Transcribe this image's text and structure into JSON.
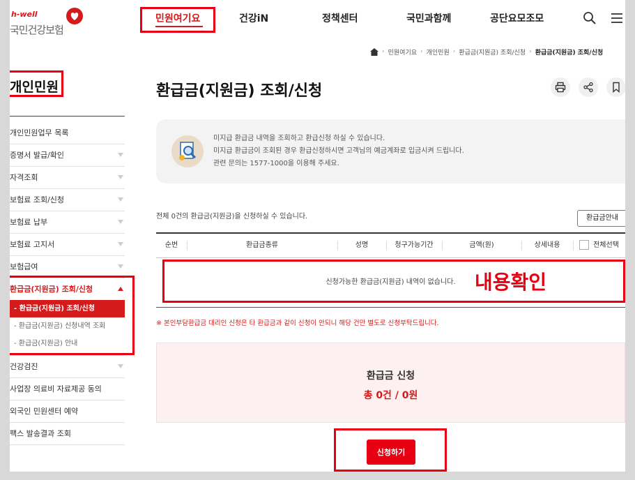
{
  "logo": {
    "en": "h-well",
    "ko": "국민건강보험"
  },
  "gnb": {
    "items": [
      "민원여기요",
      "건강iN",
      "정책센터",
      "국민과함께",
      "공단요모조모"
    ]
  },
  "breadcrumb": [
    "민원여기요",
    "개인민원",
    "환급금(지원금) 조회/신청",
    "환급금(지원금) 조회/신청"
  ],
  "sidebar": {
    "title": "개인민원",
    "items": [
      {
        "label": "개인민원업무 목록"
      },
      {
        "label": "증명서 발급/확인"
      },
      {
        "label": "자격조회"
      },
      {
        "label": "보험료 조회/신청"
      },
      {
        "label": "보험료 납부"
      },
      {
        "label": "보험료 고지서"
      },
      {
        "label": "보험급여"
      },
      {
        "label": "환급금(지원금) 조회/신청"
      },
      {
        "label": "건강검진"
      },
      {
        "label": "사업장 의료비 자료제공 동의"
      },
      {
        "label": "외국인 민원센터 예약"
      },
      {
        "label": "팩스 발송결과 조회"
      }
    ],
    "sub": [
      "환급금(지원금) 조회/신청",
      "환급금(지원금) 신청내역 조회",
      "환급금(지원금) 안내"
    ]
  },
  "main": {
    "title": "환급금(지원금) 조회/신청",
    "info_lines": [
      "미지급 환급금 내역을 조회하고 환급신청 하실 수 있습니다.",
      "미지급 환급금이 조회된 경우 환급신청하시면 고객님의 예금계좌로 입금시켜 드립니다.",
      "관련 문의는 1577-1000을 이용해 주세요."
    ],
    "count_text": "전체 0건의 환급금(지원금)을 신청하실 수 있습니다.",
    "guide_button": "환급금안내",
    "columns": [
      "순번",
      "환급금종류",
      "성명",
      "청구가능기간",
      "금액(원)",
      "상세내용",
      "전체선택"
    ],
    "empty_text": "신청가능한 환급금(지원금) 내역이 없습니다.",
    "annotation": "내용확인",
    "notice": "※ 본인부담환급금 대리인 신청은 타 환급금과 같이 신청이 안되니 해당 건만 별도로 신청부탁드립니다.",
    "summary_title": "환급금 신청",
    "summary_total": "총 0건 / 0원",
    "apply_button": "신청하기"
  },
  "colors": {
    "accent": "#d41a1a",
    "highlight_box": "#e60012"
  }
}
